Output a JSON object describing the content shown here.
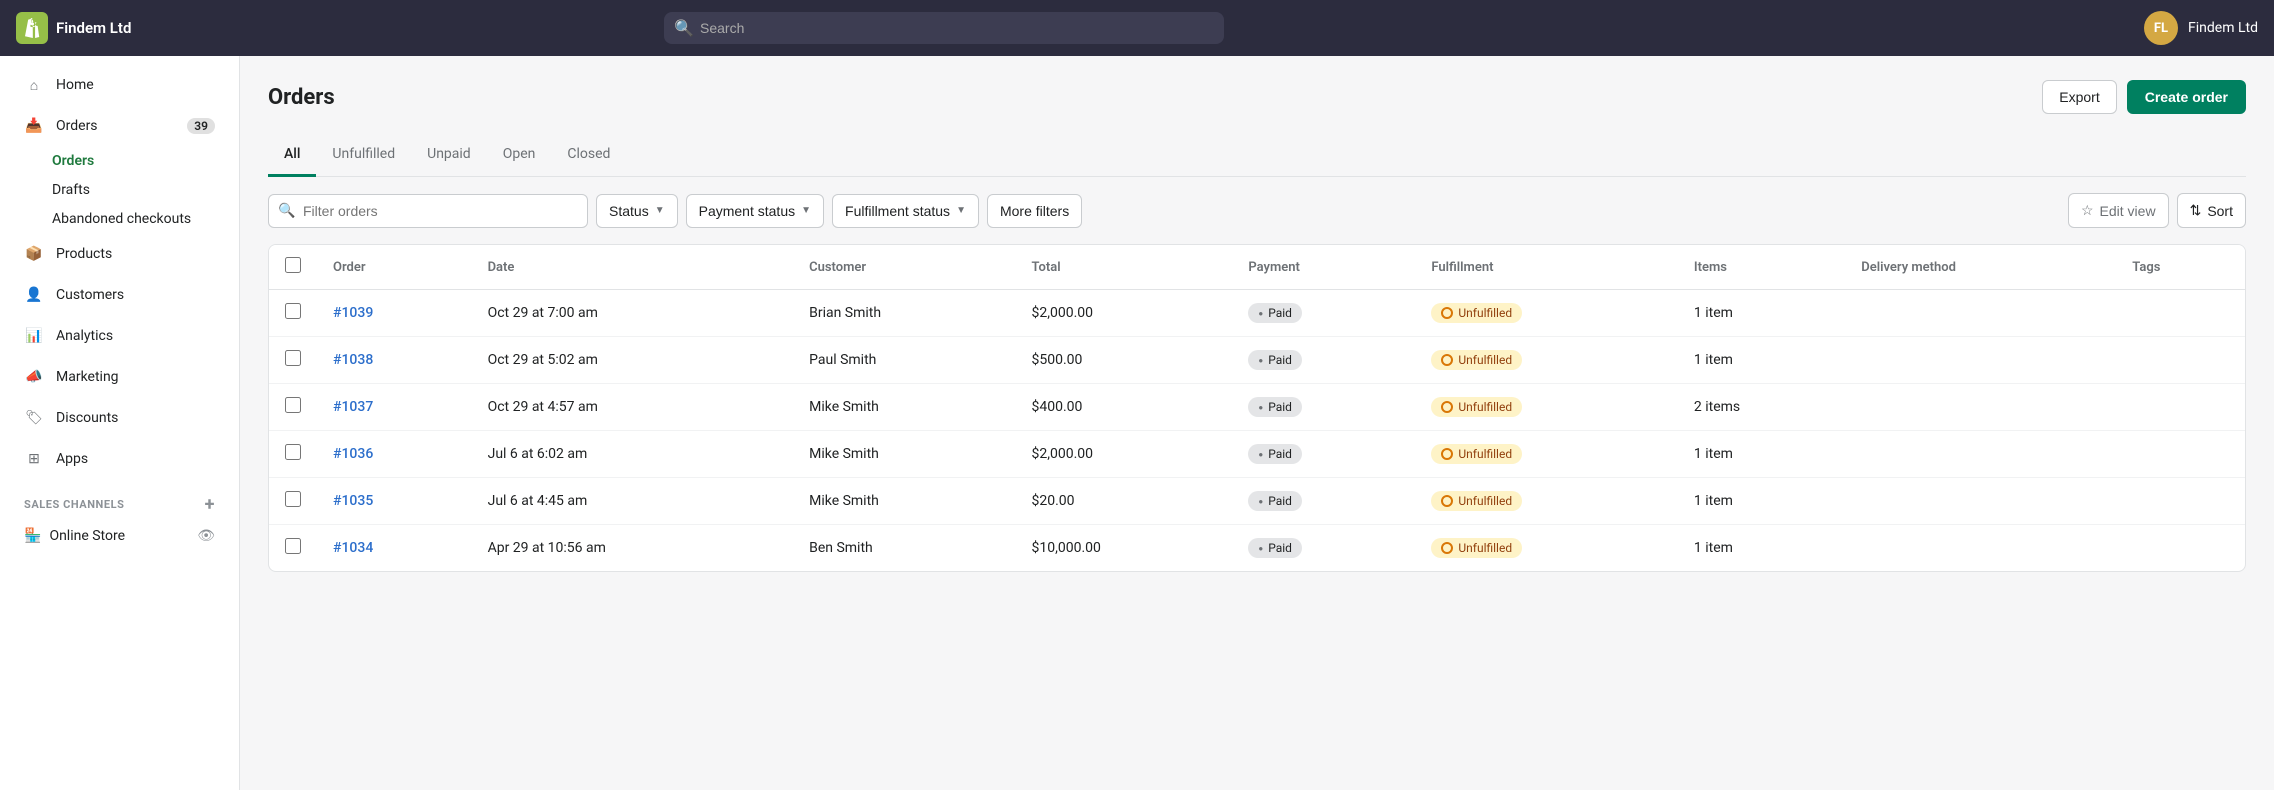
{
  "topbar": {
    "company": "Findem Ltd",
    "search_placeholder": "Search",
    "user_initials": "FL",
    "username": "Findem Ltd"
  },
  "sidebar": {
    "items": [
      {
        "id": "home",
        "label": "Home",
        "icon": "home"
      },
      {
        "id": "orders",
        "label": "Orders",
        "icon": "orders",
        "badge": "39"
      },
      {
        "id": "products",
        "label": "Products",
        "icon": "products"
      },
      {
        "id": "customers",
        "label": "Customers",
        "icon": "customers"
      },
      {
        "id": "analytics",
        "label": "Analytics",
        "icon": "analytics"
      },
      {
        "id": "marketing",
        "label": "Marketing",
        "icon": "marketing"
      },
      {
        "id": "discounts",
        "label": "Discounts",
        "icon": "discounts"
      },
      {
        "id": "apps",
        "label": "Apps",
        "icon": "apps"
      }
    ],
    "orders_subitems": [
      {
        "id": "orders-sub",
        "label": "Orders",
        "active": true
      },
      {
        "id": "drafts",
        "label": "Drafts"
      },
      {
        "id": "abandoned",
        "label": "Abandoned checkouts"
      }
    ],
    "sales_channels_label": "SALES CHANNELS",
    "online_store_label": "Online Store"
  },
  "page": {
    "title": "Orders",
    "export_label": "Export",
    "create_order_label": "Create order"
  },
  "tabs": [
    {
      "id": "all",
      "label": "All",
      "active": true
    },
    {
      "id": "unfulfilled",
      "label": "Unfulfilled"
    },
    {
      "id": "unpaid",
      "label": "Unpaid"
    },
    {
      "id": "open",
      "label": "Open"
    },
    {
      "id": "closed",
      "label": "Closed"
    }
  ],
  "filters": {
    "search_placeholder": "Filter orders",
    "status_label": "Status",
    "payment_status_label": "Payment status",
    "fulfillment_status_label": "Fulfillment status",
    "more_filters_label": "More filters",
    "edit_view_label": "Edit view",
    "sort_label": "Sort"
  },
  "table": {
    "columns": [
      "Order",
      "Date",
      "Customer",
      "Total",
      "Payment",
      "Fulfillment",
      "Items",
      "Delivery method",
      "Tags"
    ],
    "rows": [
      {
        "order": "#1039",
        "date": "Oct 29 at 7:00 am",
        "customer": "Brian Smith",
        "total": "$2,000.00",
        "payment": "Paid",
        "fulfillment": "Unfulfilled",
        "items": "1 item",
        "delivery": "",
        "tags": ""
      },
      {
        "order": "#1038",
        "date": "Oct 29 at 5:02 am",
        "customer": "Paul Smith",
        "total": "$500.00",
        "payment": "Paid",
        "fulfillment": "Unfulfilled",
        "items": "1 item",
        "delivery": "",
        "tags": ""
      },
      {
        "order": "#1037",
        "date": "Oct 29 at 4:57 am",
        "customer": "Mike Smith",
        "total": "$400.00",
        "payment": "Paid",
        "fulfillment": "Unfulfilled",
        "items": "2 items",
        "delivery": "",
        "tags": ""
      },
      {
        "order": "#1036",
        "date": "Jul 6 at 6:02 am",
        "customer": "Mike Smith",
        "total": "$2,000.00",
        "payment": "Paid",
        "fulfillment": "Unfulfilled",
        "items": "1 item",
        "delivery": "",
        "tags": ""
      },
      {
        "order": "#1035",
        "date": "Jul 6 at 4:45 am",
        "customer": "Mike Smith",
        "total": "$20.00",
        "payment": "Paid",
        "fulfillment": "Unfulfilled",
        "items": "1 item",
        "delivery": "",
        "tags": ""
      },
      {
        "order": "#1034",
        "date": "Apr 29 at 10:56 am",
        "customer": "Ben Smith",
        "total": "$10,000.00",
        "payment": "Paid",
        "fulfillment": "Unfulfilled",
        "items": "1 item",
        "delivery": "",
        "tags": ""
      }
    ]
  }
}
